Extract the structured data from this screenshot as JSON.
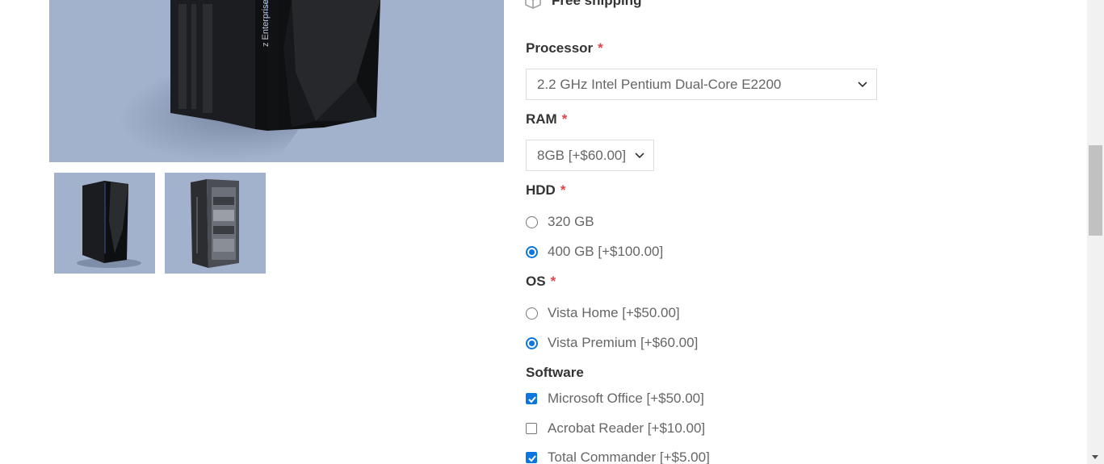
{
  "shipping": {
    "label": "Free shipping",
    "icon": "box-icon"
  },
  "product_images": {
    "main": {
      "brand_text": "z Enterprise"
    },
    "thumbnails": [
      "server-front-thumbnail",
      "server-open-thumbnail"
    ]
  },
  "options": {
    "processor": {
      "label": "Processor",
      "required": "*",
      "selected": "2.2 GHz Intel Pentium Dual-Core E2200"
    },
    "ram": {
      "label": "RAM",
      "required": "*",
      "selected": "8GB [+$60.00]"
    },
    "hdd": {
      "label": "HDD",
      "required": "*",
      "choices": [
        {
          "label": "320 GB",
          "checked": false
        },
        {
          "label": "400 GB [+$100.00]",
          "checked": true
        }
      ]
    },
    "os": {
      "label": "OS",
      "required": "*",
      "choices": [
        {
          "label": "Vista Home [+$50.00]",
          "checked": false
        },
        {
          "label": "Vista Premium [+$60.00]",
          "checked": true
        }
      ]
    },
    "software": {
      "label": "Software",
      "choices": [
        {
          "label": "Microsoft Office [+$50.00]",
          "checked": true
        },
        {
          "label": "Acrobat Reader [+$10.00]",
          "checked": false
        },
        {
          "label": "Total Commander [+$5.00]",
          "checked": true
        }
      ]
    }
  },
  "colors": {
    "accent": "#0b75e0",
    "required": "#e4434b",
    "image_bg": "#a3b2cc"
  }
}
